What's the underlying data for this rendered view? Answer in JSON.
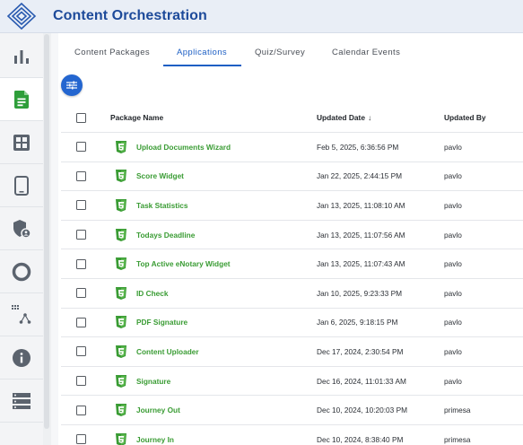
{
  "header": {
    "title": "Content Orchestration",
    "logo_icon": "diamond-logo-icon"
  },
  "sidebar": {
    "items": [
      {
        "icon": "bar-chart-icon",
        "active": false
      },
      {
        "icon": "document-icon",
        "active": true
      },
      {
        "icon": "grid-icon",
        "active": false
      },
      {
        "icon": "tablet-icon",
        "active": false
      },
      {
        "icon": "shield-user-icon",
        "active": false
      },
      {
        "icon": "circle-icon",
        "active": false
      },
      {
        "icon": "hierarchy-icon",
        "active": false
      },
      {
        "icon": "info-icon",
        "active": false
      },
      {
        "icon": "server-icon",
        "active": false
      }
    ]
  },
  "tabs": [
    {
      "label": "Content Packages",
      "active": false
    },
    {
      "label": "Applications",
      "active": true
    },
    {
      "label": "Quiz/Survey",
      "active": false
    },
    {
      "label": "Calendar Events",
      "active": false
    }
  ],
  "filter_button_icon": "filter-sliders-icon",
  "table": {
    "columns": {
      "name": "Package Name",
      "updated_date": "Updated Date",
      "sort_indicator": "↓",
      "updated_by": "Updated By"
    },
    "rows": [
      {
        "name": "Upload Documents Wizard",
        "date": "Feb 5, 2025, 6:36:56 PM",
        "by": "pavlo"
      },
      {
        "name": "Score Widget",
        "date": "Jan 22, 2025, 2:44:15 PM",
        "by": "pavlo"
      },
      {
        "name": "Task Statistics",
        "date": "Jan 13, 2025, 11:08:10 AM",
        "by": "pavlo"
      },
      {
        "name": "Todays Deadline",
        "date": "Jan 13, 2025, 11:07:56 AM",
        "by": "pavlo"
      },
      {
        "name": "Top Active eNotary Widget",
        "date": "Jan 13, 2025, 11:07:43 AM",
        "by": "pavlo"
      },
      {
        "name": "ID Check",
        "date": "Jan 10, 2025, 9:23:33 PM",
        "by": "pavlo"
      },
      {
        "name": "PDF Signature",
        "date": "Jan 6, 2025, 9:18:15 PM",
        "by": "pavlo"
      },
      {
        "name": "Content Uploader",
        "date": "Dec 17, 2024, 2:30:54 PM",
        "by": "pavlo"
      },
      {
        "name": "Signature",
        "date": "Dec 16, 2024, 11:01:33 AM",
        "by": "pavlo"
      },
      {
        "name": "Journey Out",
        "date": "Dec 10, 2024, 10:20:03 PM",
        "by": "primesa"
      },
      {
        "name": "Journey In",
        "date": "Dec 10, 2024, 8:38:40 PM",
        "by": "primesa"
      }
    ],
    "row_icon": "html5-icon"
  },
  "colors": {
    "brand": "#1d4a9a",
    "accent": "#1d5fc4",
    "package_green": "#3a9c34",
    "active_nav_green": "#2e9e3a"
  }
}
